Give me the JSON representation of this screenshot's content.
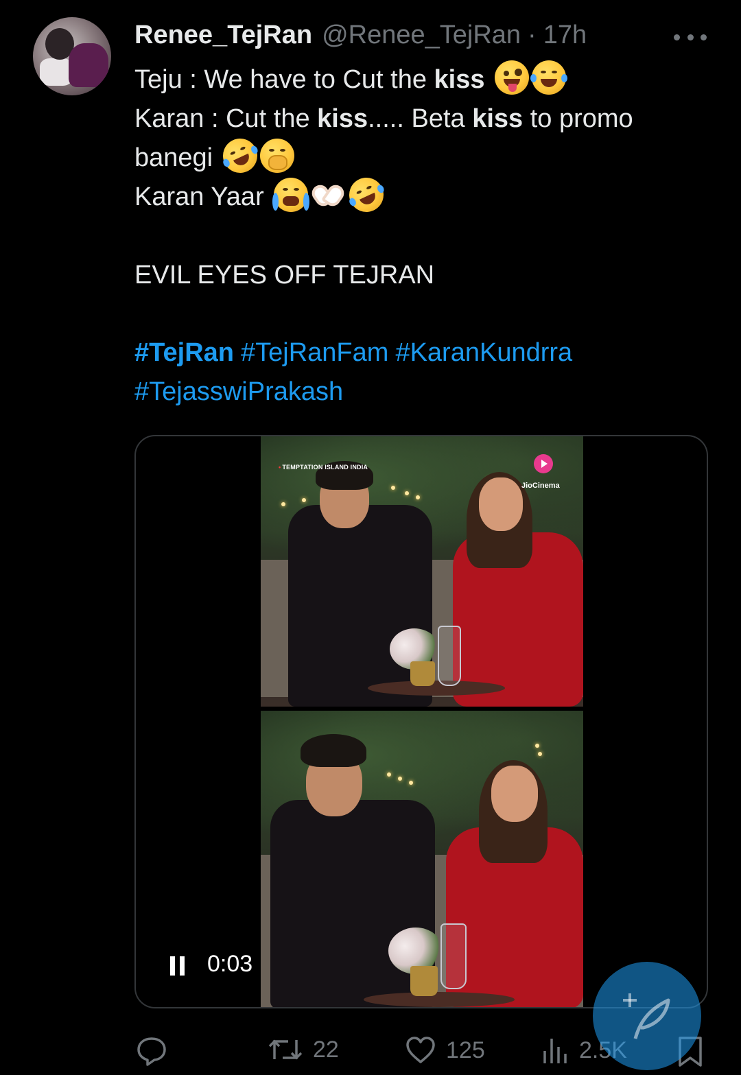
{
  "author": {
    "name": "Renee_TejRan",
    "handle": "@Renee_TejRan",
    "separator": "·",
    "time": "17h"
  },
  "tweet": {
    "line1": {
      "pre": "Teju : We have to Cut the ",
      "bold": "kiss"
    },
    "line2": {
      "pre": "Karan : Cut the ",
      "bold1": "kiss",
      "mid": "..... Beta ",
      "bold2": "kiss",
      "post": " to promo"
    },
    "line3": {
      "text": "banegi"
    },
    "line4": {
      "text": "Karan Yaar"
    },
    "line5": {
      "text": "EVIL EYES OFF TEJRAN"
    },
    "hashtags": [
      "#TejRan",
      "#TejRanFam",
      "#KaranKundrra",
      "#TejasswiPrakash"
    ]
  },
  "emojis": {
    "line1": [
      "zany-face",
      "tears-of-joy"
    ],
    "line3": [
      "rolling-on-floor-laughing",
      "face-with-hand-over-mouth"
    ],
    "line4": [
      "loudly-crying-face",
      "heart-hands",
      "rolling-on-floor-laughing"
    ]
  },
  "media": {
    "overlay_label": "TEMPTATION ISLAND INDIA",
    "brand": "JioCinema",
    "time": "0:03",
    "state": "playing"
  },
  "actions": {
    "retweets": "22",
    "likes": "125",
    "views": "2.5K"
  },
  "colors": {
    "background": "#000000",
    "text": "#e7e9ea",
    "muted": "#71767b",
    "link": "#1d9bf0",
    "fab": "#1d9bf0"
  }
}
